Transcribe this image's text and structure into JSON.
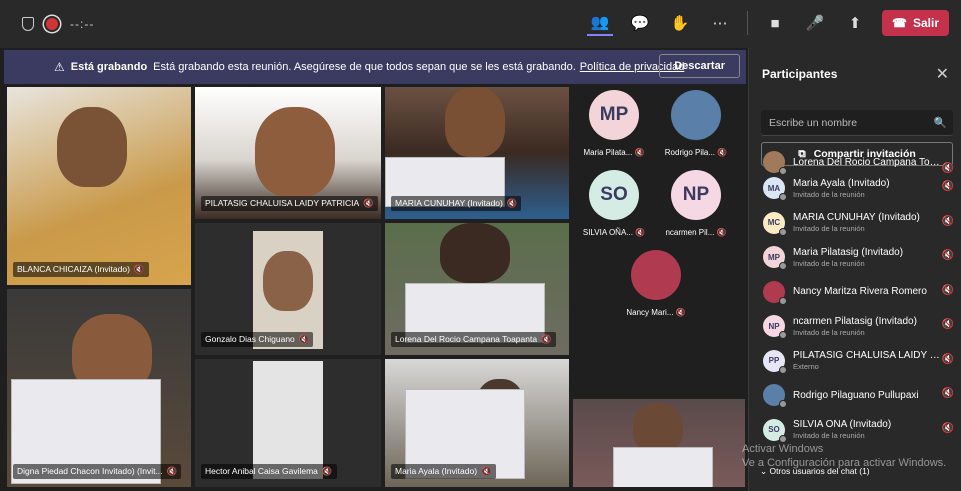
{
  "toolbar": {
    "timer": "--:--",
    "leave_label": "Salir"
  },
  "banner": {
    "title": "Está grabando",
    "message": "Está grabando esta reunión. Asegúrese de que todos sepan que se les está grabando.",
    "link": "Política de privacidad",
    "discard": "Descartar"
  },
  "tiles": [
    {
      "name": "BLANCA CHICAIZA (Invitado)"
    },
    {
      "name": "PILATASIG CHALUISA LAIDY PATRICIA"
    },
    {
      "name": "MARIA CUNUHAY (Invitado)"
    },
    {
      "name": "Gonzalo Dias Chiguano"
    },
    {
      "name": "Lorena Del Rocio Campana Toapanta"
    },
    {
      "name": "Digna Piedad Chacon Invitado) (Invit..."
    },
    {
      "name": "Hector Anibal Caisa Gavilema"
    },
    {
      "name": "Maria Ayala (Invitado)"
    }
  ],
  "gallery": [
    {
      "initials": "MP",
      "label": "Maria Pilata...",
      "color": "#f2d4d9"
    },
    {
      "initials": "",
      "label": "Rodrigo Pila...",
      "color": "#5a7fa8"
    },
    {
      "initials": "SO",
      "label": "SILVIA OÑA...",
      "color": "#d4ece4"
    },
    {
      "initials": "NP",
      "label": "ncarmen Pil...",
      "color": "#f6d7e4"
    },
    {
      "initials": "",
      "label": "Nancy Mari...",
      "color": "#b03a50"
    }
  ],
  "panel": {
    "title": "Participantes",
    "search_placeholder": "Escribe un nombre",
    "invite_label": "Compartir invitación",
    "participants": [
      {
        "initials": "",
        "name": "Lorena Del Rocio Campana Toap...",
        "sub": "",
        "color": "#a07a5a"
      },
      {
        "initials": "MA",
        "name": "Maria Ayala (Invitado)",
        "sub": "Invitado de la reunión",
        "color": "#dbe6f4"
      },
      {
        "initials": "MC",
        "name": "MARIA CUNUHAY (Invitado)",
        "sub": "Invitado de la reunión",
        "color": "#f8ebc4"
      },
      {
        "initials": "MP",
        "name": "Maria Pilatasig (Invitado)",
        "sub": "Invitado de la reunión",
        "color": "#f2d4d9"
      },
      {
        "initials": "",
        "name": "Nancy Maritza Rivera Romero",
        "sub": "",
        "color": "#b03a50"
      },
      {
        "initials": "NP",
        "name": "ncarmen Pilatasig (Invitado)",
        "sub": "Invitado de la reunión",
        "color": "#f6d7e4"
      },
      {
        "initials": "PP",
        "name": "PILATASIG CHALUISA LAIDY PAT...",
        "sub": "Externo",
        "color": "#e6e6f6"
      },
      {
        "initials": "",
        "name": "Rodrigo Pilaguano Pullupaxi",
        "sub": "",
        "color": "#5a7fa8"
      },
      {
        "initials": "SO",
        "name": "SILVIA OÑA (Invitado)",
        "sub": "Invitado de la reunión",
        "color": "#d4ece4"
      }
    ],
    "more": "Otros usuarios del chat (1)"
  },
  "watermark": {
    "line1": "Activar Windows",
    "line2": "Ve a Configuración para activar Windows."
  }
}
